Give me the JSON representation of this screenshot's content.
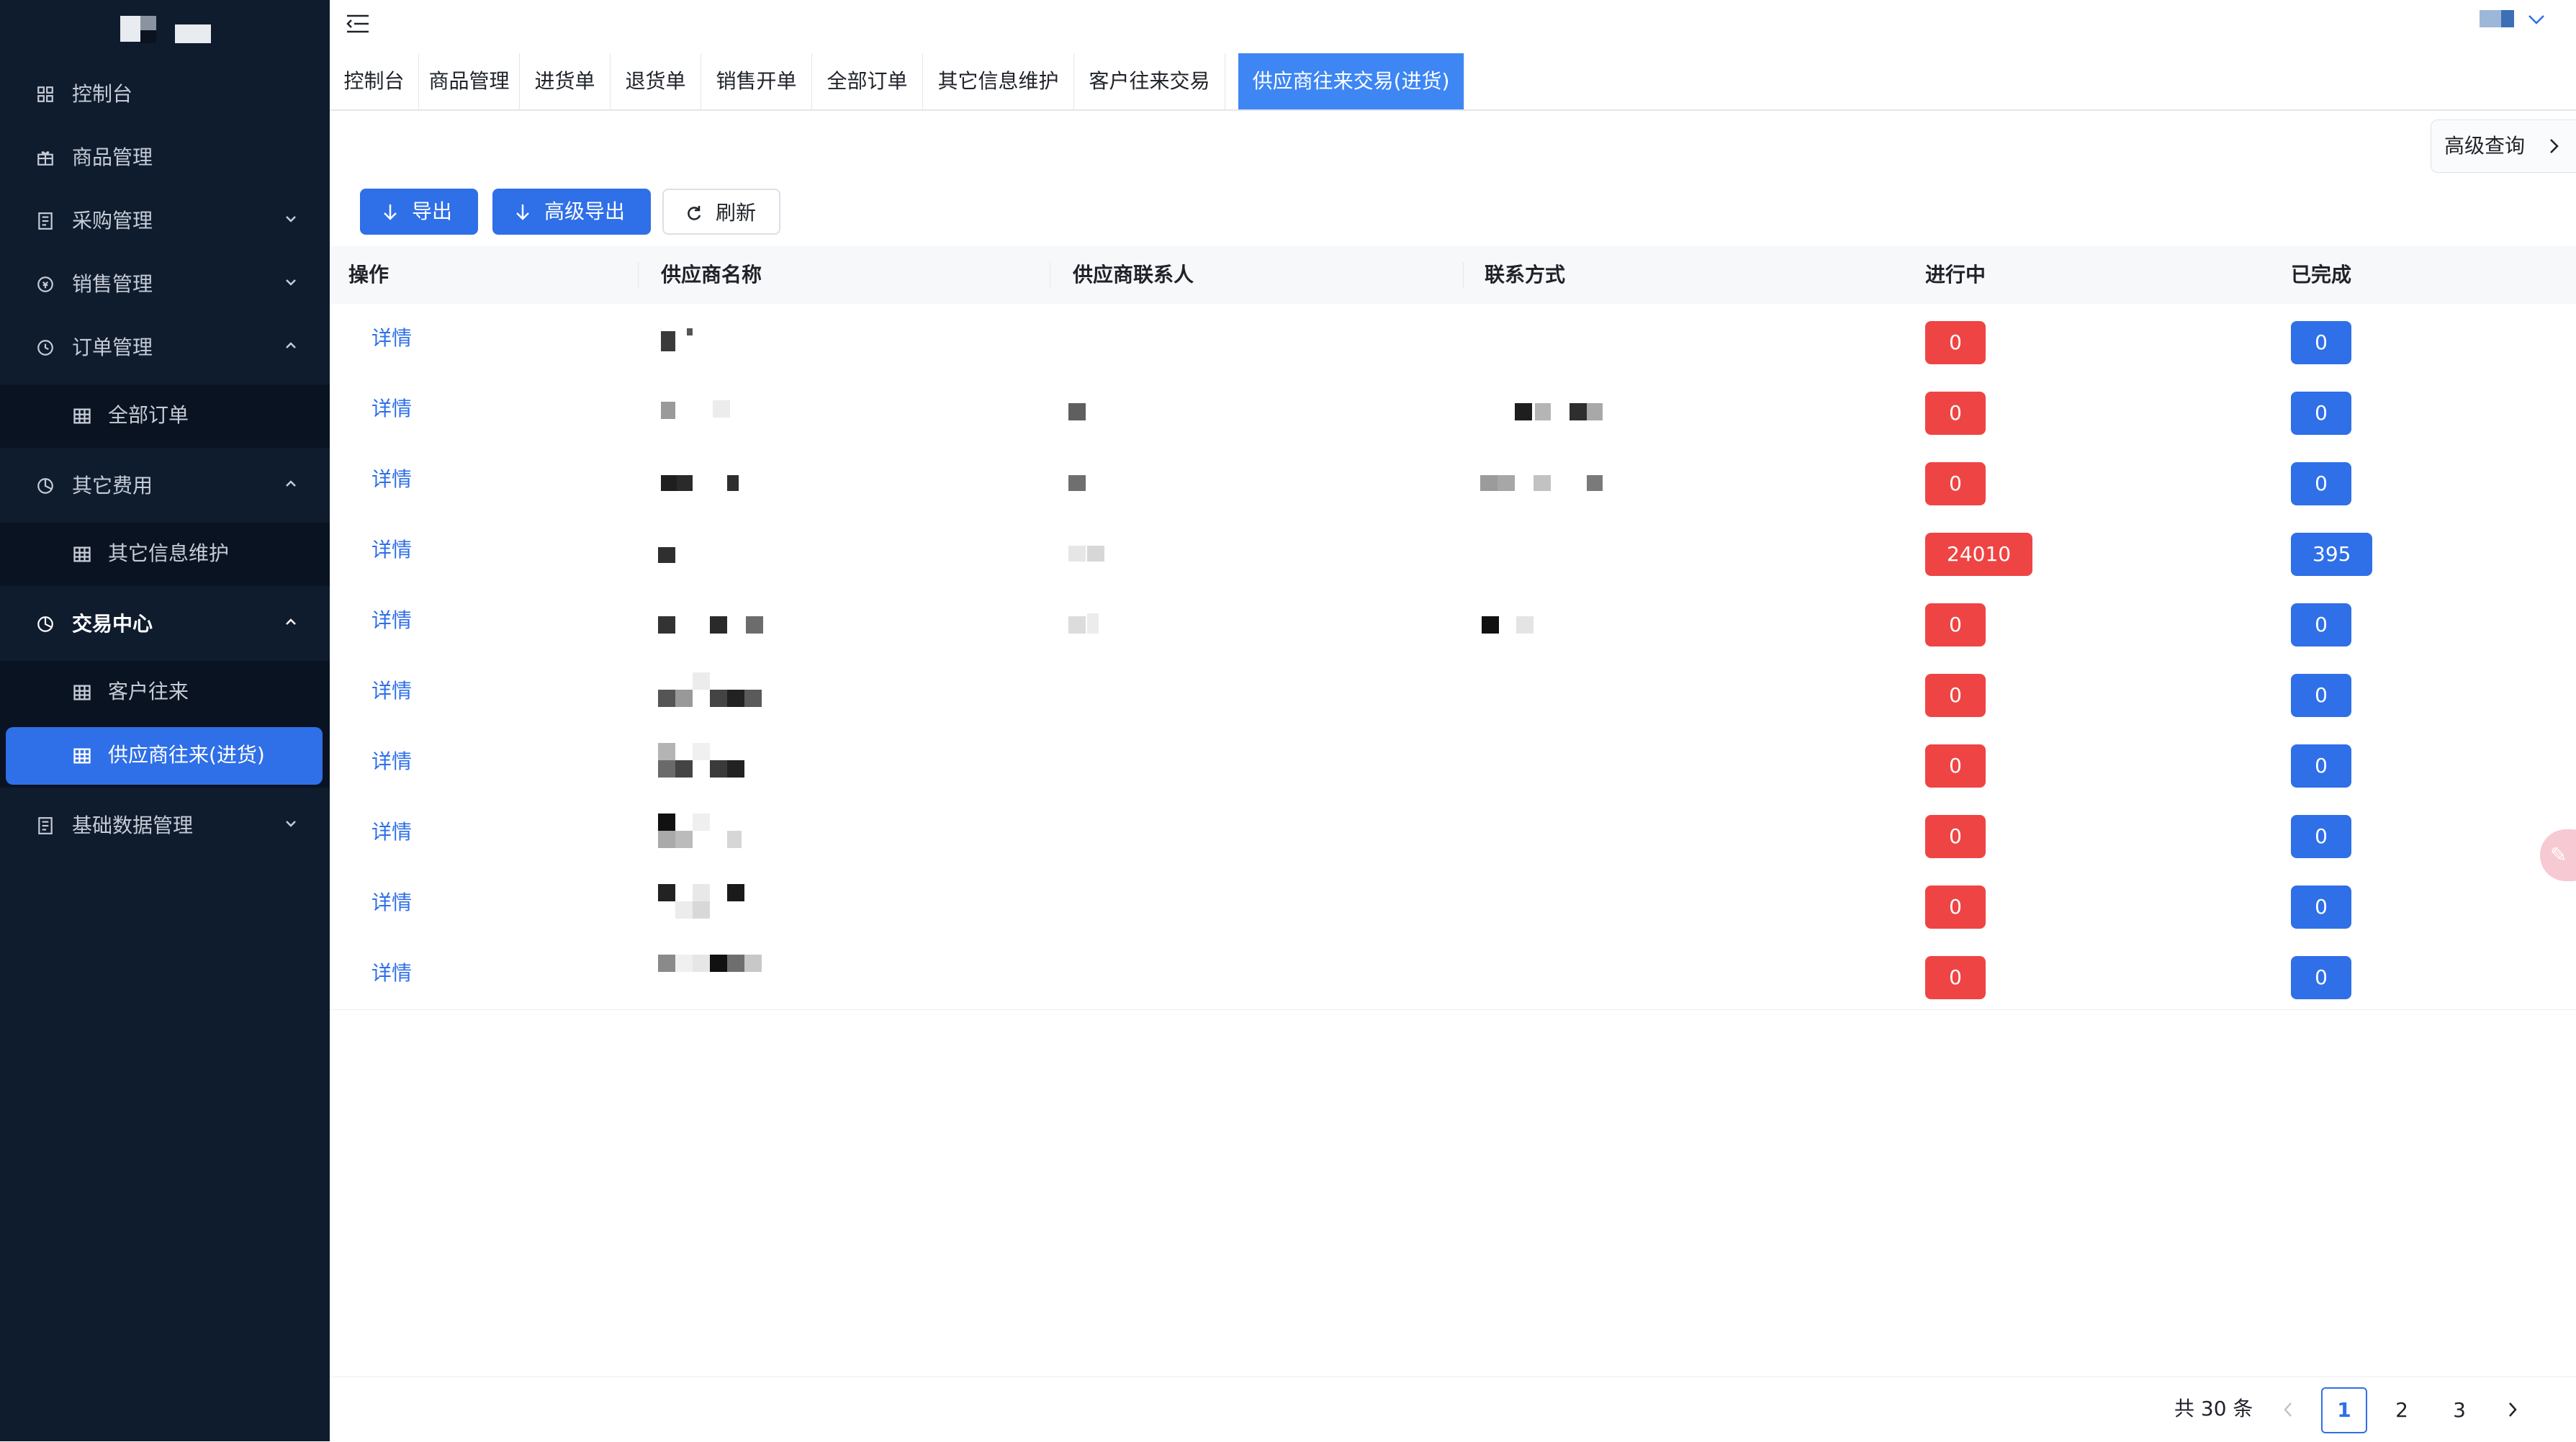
{
  "sidebar": {
    "items": [
      {
        "label": "控制台",
        "icon": "grid-icon"
      },
      {
        "label": "商品管理",
        "icon": "gift-icon"
      },
      {
        "label": "采购管理",
        "icon": "document-icon",
        "expandable": true,
        "expanded": false
      },
      {
        "label": "销售管理",
        "icon": "sales-icon",
        "expandable": true,
        "expanded": false
      },
      {
        "label": "订单管理",
        "icon": "clock-icon",
        "expandable": true,
        "expanded": true,
        "children": [
          {
            "label": "全部订单",
            "icon": "table-icon"
          }
        ]
      },
      {
        "label": "其它费用",
        "icon": "pie-icon",
        "expandable": true,
        "expanded": true,
        "children": [
          {
            "label": "其它信息维护",
            "icon": "table-icon"
          }
        ]
      },
      {
        "label": "交易中心",
        "icon": "pie-icon",
        "expandable": true,
        "expanded": true,
        "active": true,
        "children": [
          {
            "label": "客户往来",
            "icon": "table-icon"
          },
          {
            "label": "供应商往来(进货)",
            "icon": "table-icon",
            "selected": true
          }
        ]
      },
      {
        "label": "基础数据管理",
        "icon": "document-icon",
        "expandable": true,
        "expanded": false
      }
    ]
  },
  "tabs": [
    {
      "label": "控制台"
    },
    {
      "label": "商品管理"
    },
    {
      "label": "进货单"
    },
    {
      "label": "退货单"
    },
    {
      "label": "销售开单"
    },
    {
      "label": "全部订单"
    },
    {
      "label": "其它信息维护"
    },
    {
      "label": "客户往来交易"
    },
    {
      "label": "供应商往来交易(进货)",
      "active": true
    }
  ],
  "toolbar": {
    "advanced_query_label": "高级查询",
    "export_label": "导出",
    "advanced_export_label": "高级导出",
    "refresh_label": "刷新"
  },
  "table": {
    "columns": [
      "操作",
      "供应商名称",
      "供应商联系人",
      "联系方式",
      "进行中",
      "已完成"
    ],
    "action_label": "详情",
    "rows": [
      {
        "in_progress": "0",
        "completed": "0"
      },
      {
        "in_progress": "0",
        "completed": "0"
      },
      {
        "in_progress": "0",
        "completed": "0"
      },
      {
        "in_progress": "24010",
        "completed": "395"
      },
      {
        "in_progress": "0",
        "completed": "0"
      },
      {
        "in_progress": "0",
        "completed": "0"
      },
      {
        "in_progress": "0",
        "completed": "0"
      },
      {
        "in_progress": "0",
        "completed": "0"
      },
      {
        "in_progress": "0",
        "completed": "0"
      },
      {
        "in_progress": "0",
        "completed": "0"
      }
    ]
  },
  "pagination": {
    "total_text": "共 30 条",
    "pages": [
      "1",
      "2",
      "3"
    ],
    "current": "1"
  },
  "colors": {
    "sidebar_bg": "#0f1c2e",
    "accent": "#2f6fe8",
    "badge_in_progress": "#ef4444",
    "badge_completed": "#2f6fe8"
  }
}
